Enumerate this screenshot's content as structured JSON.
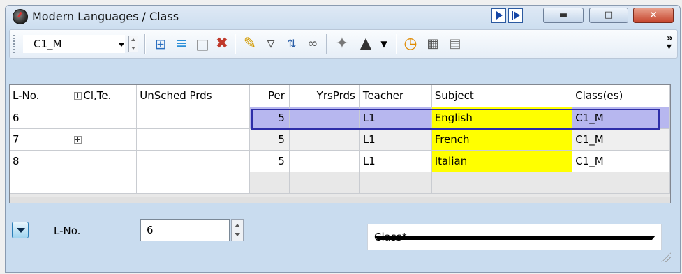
{
  "window": {
    "title": "Modern Languages / Class"
  },
  "toolbar": {
    "class_select": "C1_M",
    "icons": [
      "lesson-add-icon",
      "lesson-list-icon",
      "new-lesson-icon",
      "delete-icon",
      "edit-pencil-icon",
      "filter-icon",
      "sort-icon",
      "link-icon",
      "rocket-icon",
      "graduation-cap-icon",
      "clock-icon",
      "calendar-icon",
      "table-icon"
    ]
  },
  "grid": {
    "columns": [
      "L-No.",
      "Cl,Te.",
      "UnSched Prds",
      "Per",
      "YrsPrds",
      "Teacher",
      "Subject",
      "Class(es)"
    ],
    "rows": [
      {
        "lno": "6",
        "clte": "",
        "unsched": "",
        "per": "5",
        "yrsprds": "",
        "teacher": "L1",
        "subject": "English",
        "classes": "C1_M"
      },
      {
        "lno": "7",
        "clte": "",
        "unsched": "",
        "per": "5",
        "yrsprds": "",
        "teacher": "L1",
        "subject": "French",
        "classes": "C1_M"
      },
      {
        "lno": "8",
        "clte": "",
        "unsched": "",
        "per": "5",
        "yrsprds": "",
        "teacher": "L1",
        "subject": "Italian",
        "classes": "C1_M"
      }
    ]
  },
  "bottom": {
    "lno_label": "L-No.",
    "lno_value": "6",
    "view_select": "Class*"
  },
  "colors": {
    "subject_highlight": "#ffff00",
    "selected_row": "#b7b7ef",
    "selection_border": "#2e2ea8"
  }
}
